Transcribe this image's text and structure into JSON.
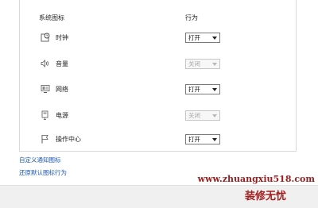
{
  "table": {
    "col_icon": "系统图标",
    "col_behavior": "行为",
    "rows": [
      {
        "name": "时钟",
        "icon": "clock-icon",
        "behavior": "打开",
        "enabled": true
      },
      {
        "name": "音量",
        "icon": "volume-icon",
        "behavior": "关闭",
        "enabled": false
      },
      {
        "name": "网络",
        "icon": "network-icon",
        "behavior": "打开",
        "enabled": true
      },
      {
        "name": "电源",
        "icon": "power-icon",
        "behavior": "关闭",
        "enabled": false
      },
      {
        "name": "操作中心",
        "icon": "action-center-flag-icon",
        "behavior": "打开",
        "enabled": true
      }
    ]
  },
  "links": {
    "customize": "自定义通知图标",
    "restore": "还原默认图标行为"
  },
  "watermark": {
    "url": "www.zhuangxiu518.com",
    "text": "装修无忧"
  },
  "colors": {
    "link": "#1a55b5",
    "watermark": "#a32020"
  }
}
